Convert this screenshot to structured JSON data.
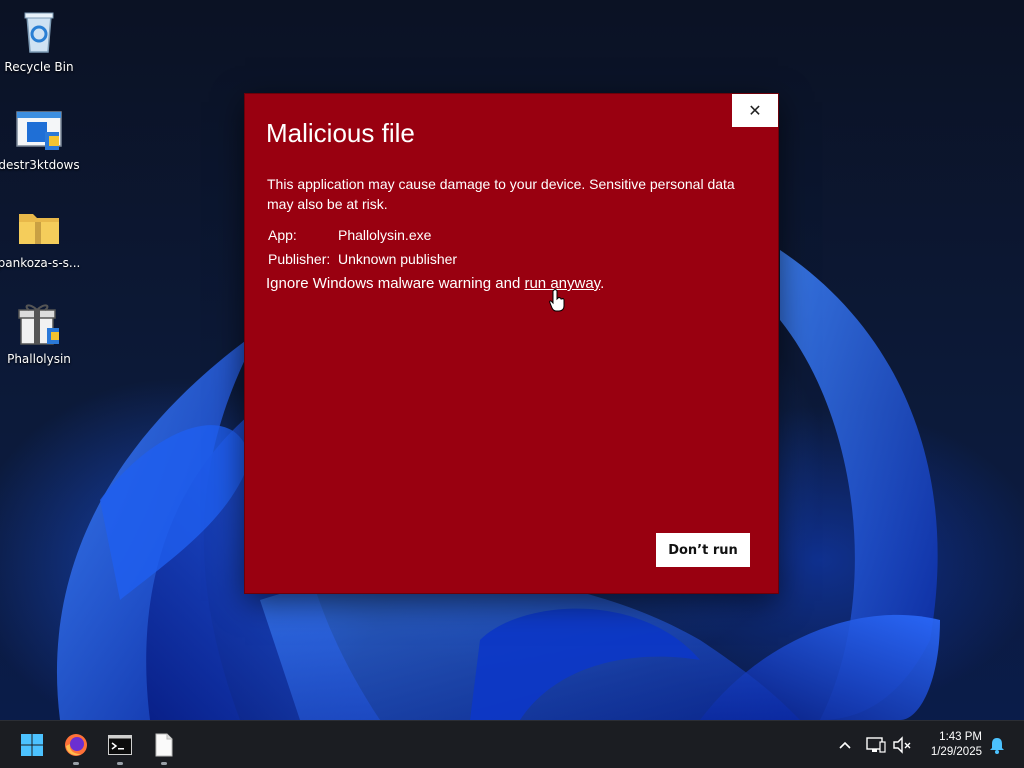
{
  "desktop": {
    "icons": [
      {
        "label": "Recycle Bin",
        "icon": "recycle-bin-icon"
      },
      {
        "label": "destr3ktdows",
        "icon": "installer-icon"
      },
      {
        "label": "pankoza-s-s...",
        "icon": "zip-folder-icon"
      },
      {
        "label": "Phallolysin",
        "icon": "gift-installer-icon"
      }
    ]
  },
  "dialog": {
    "title": "Malicious file",
    "close_symbol": "✕",
    "message": "This application may cause damage to your device. Sensitive personal data may also be at risk.",
    "app_label": "App:",
    "app_value": "Phallolysin.exe",
    "publisher_label": "Publisher:",
    "publisher_value": "Unknown publisher",
    "ignore_text": "Ignore Windows malware warning and ",
    "run_anyway": "run anyway",
    "period": ".",
    "dont_run": "Don’t run",
    "background_color": "#990010"
  },
  "taskbar": {
    "apps": [
      "windows-start-icon",
      "firefox-icon",
      "terminal-icon",
      "file-icon"
    ],
    "tray": [
      "chevron-up-icon",
      "network-icon",
      "volume-muted-icon",
      "notification-bell-icon"
    ],
    "time": "1:43 PM",
    "date": "1/29/2025"
  }
}
